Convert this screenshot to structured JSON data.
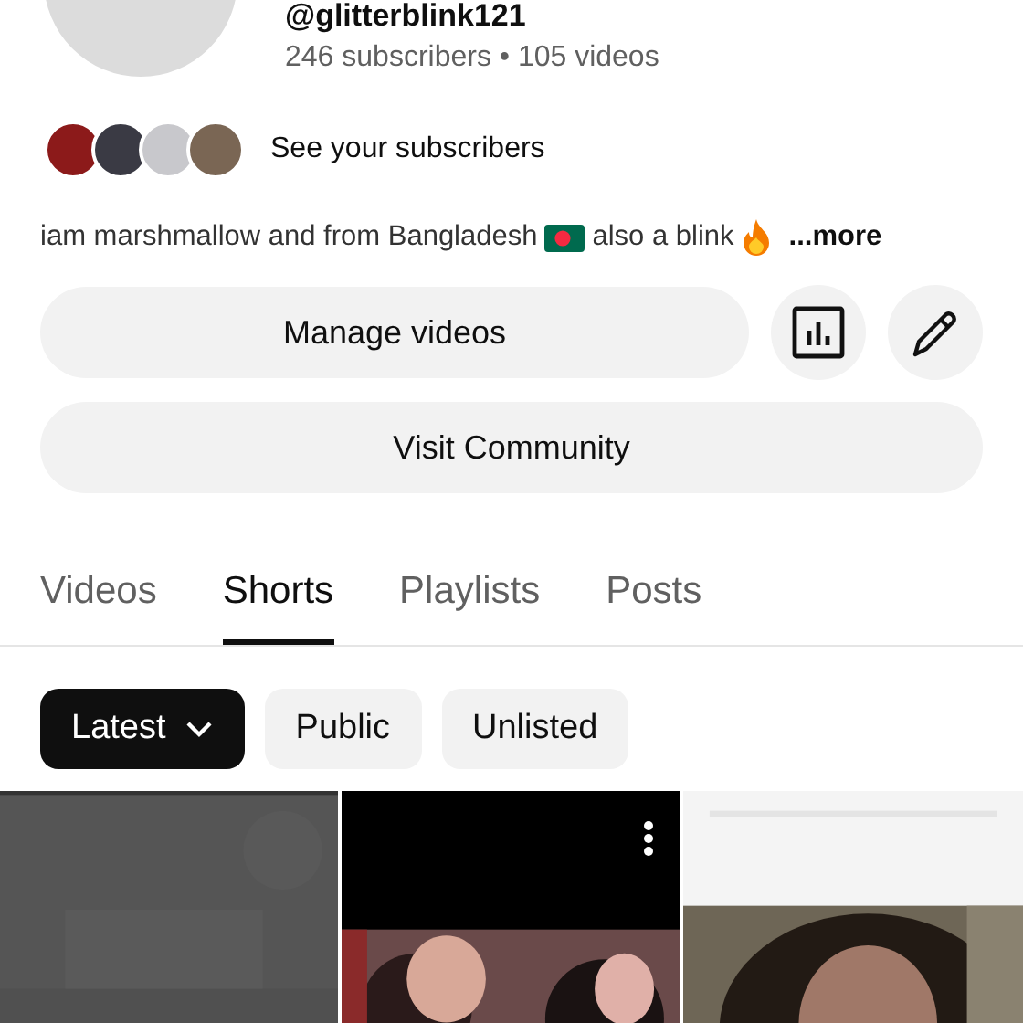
{
  "channel": {
    "handle": "@glitterblink121",
    "stats": "246 subscribers • 105 videos"
  },
  "subscribers_link": "See your subscribers",
  "description": {
    "parts": [
      {
        "kind": "text",
        "text": "iam marshmallow and from Bangladesh"
      },
      {
        "kind": "flag"
      },
      {
        "kind": "text",
        "text": "also a blink"
      },
      {
        "kind": "fire"
      }
    ],
    "more": "...more"
  },
  "buttons": {
    "manage": "Manage videos",
    "community": "Visit Community"
  },
  "tabs": [
    {
      "label": "Videos",
      "selected": false
    },
    {
      "label": "Shorts",
      "selected": true
    },
    {
      "label": "Playlists",
      "selected": false
    },
    {
      "label": "Posts",
      "selected": false
    }
  ],
  "chips": [
    {
      "label": "Latest",
      "selected": true,
      "dropdown": true
    },
    {
      "label": "Public",
      "selected": false,
      "dropdown": false
    },
    {
      "label": "Unlisted",
      "selected": false,
      "dropdown": false
    }
  ],
  "shorts": [
    {
      "kind": "picture",
      "menu": false
    },
    {
      "kind": "picture",
      "menu": true
    },
    {
      "kind": "picture",
      "menu": false
    }
  ]
}
